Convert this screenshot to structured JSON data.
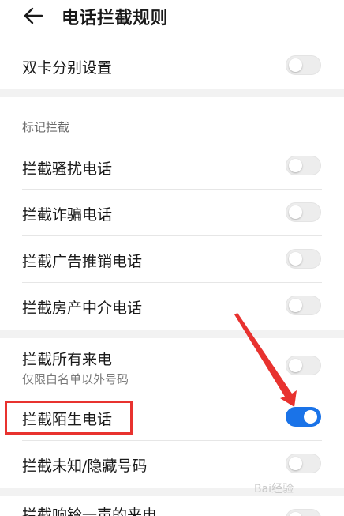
{
  "header": {
    "title": "电话拦截规则"
  },
  "dual_sim": {
    "label": "双卡分别设置",
    "toggle": false
  },
  "section": {
    "title": "标记拦截"
  },
  "marked_items": [
    {
      "label": "拦截骚扰电话",
      "toggle": false
    },
    {
      "label": "拦截诈骗电话",
      "toggle": false
    },
    {
      "label": "拦截广告推销电话",
      "toggle": false
    },
    {
      "label": "拦截房产中介电话",
      "toggle": false
    }
  ],
  "all_calls": {
    "label": "拦截所有来电",
    "sub": "仅限白名单以外号码",
    "toggle": false
  },
  "stranger": {
    "label": "拦截陌生电话",
    "toggle": true
  },
  "unknown": {
    "label": "拦截未知/隐藏号码",
    "toggle": false
  },
  "ring_once": {
    "label": "拦截响铃一声的来电",
    "toggle": false
  },
  "watermark": {
    "text": "Bai经验"
  },
  "colors": {
    "accent": "#1a73e8",
    "annotation": "#e8322f"
  },
  "icons": {
    "back": "back-arrow-icon"
  }
}
